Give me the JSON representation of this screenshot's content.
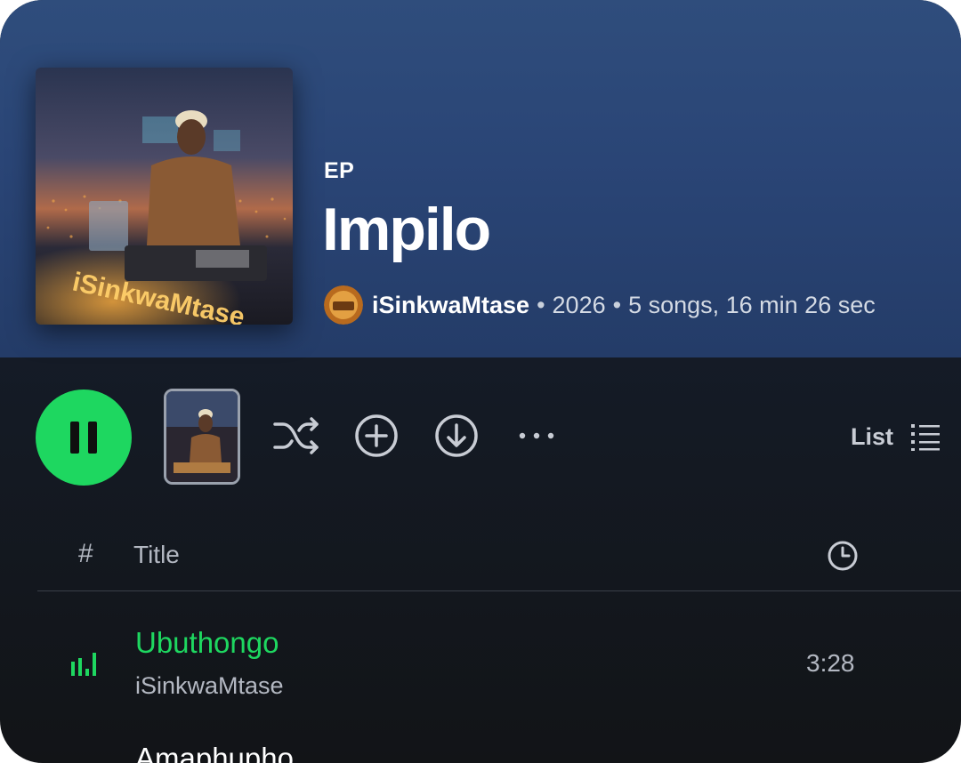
{
  "album": {
    "type_label": "EP",
    "title": "Impilo",
    "artist": "iSinkwaMtase",
    "year": "2026",
    "summary": "5 songs, 16 min 26 sec",
    "separator": "•",
    "cover_text": "iSinkwaMtase"
  },
  "colors": {
    "accent": "#1ed760",
    "header_bg": "#2a4576",
    "body_bg": "#121417"
  },
  "actions": {
    "play_state": "playing",
    "icons": [
      "pause-icon",
      "shuffle-icon",
      "add-icon",
      "download-icon",
      "more-options-icon",
      "list-icon"
    ],
    "view_label": "List"
  },
  "table": {
    "num_header": "#",
    "title_header": "Title",
    "duration_header_icon": "clock-icon"
  },
  "tracks": [
    {
      "title": "Ubuthongo",
      "artist": "iSinkwaMtase",
      "duration": "3:28",
      "playing": true
    },
    {
      "title": "Amaphupho",
      "artist": "",
      "duration": "",
      "playing": false
    }
  ]
}
